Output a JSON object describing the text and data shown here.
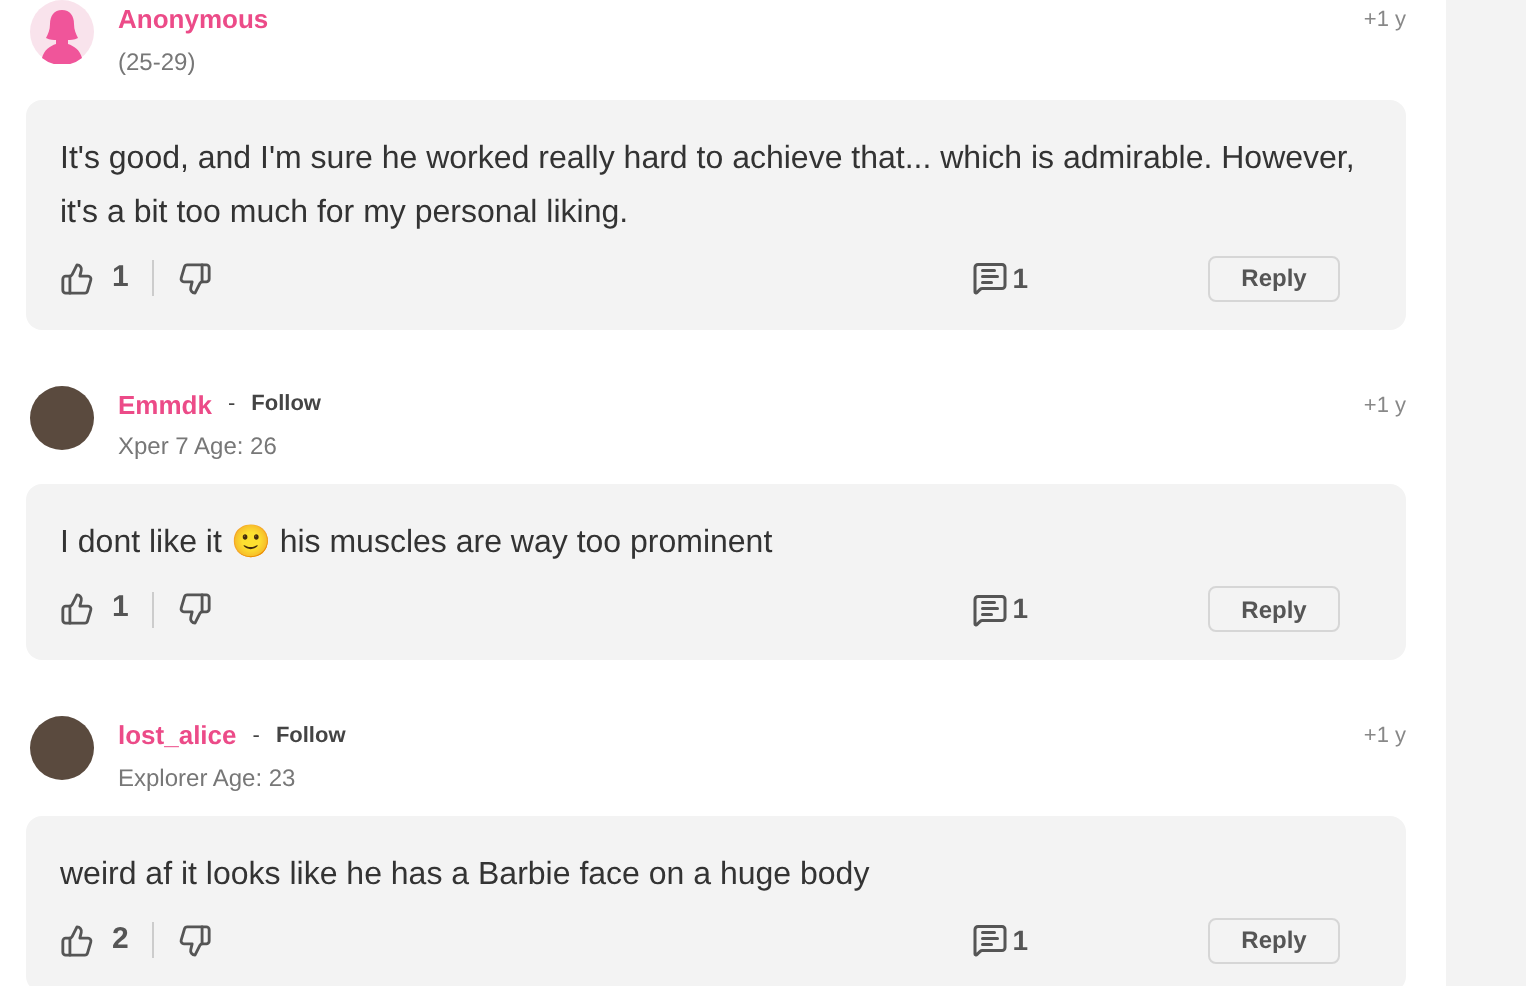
{
  "comments": [
    {
      "author": "Anonymous",
      "kind": "anonymous",
      "meta": "(25-29)",
      "time": "+1 y",
      "text": "It's good, and I'm sure he worked really hard to achieve that... which is admirable. However, it's a bit too much for my personal liking.",
      "likes": "1",
      "replies": "1",
      "reply_label": "Reply"
    },
    {
      "author": "Emmdk",
      "kind": "photo",
      "separator": "-",
      "follow": "Follow",
      "meta": "Xper 7 Age: 26",
      "time": "+1 y",
      "text": "I dont like it 🙂 his muscles are way too prominent",
      "likes": "1",
      "replies": "1",
      "reply_label": "Reply"
    },
    {
      "author": "lost_alice",
      "kind": "photo",
      "separator": "-",
      "follow": "Follow",
      "meta": "Explorer Age: 23",
      "time": "+1 y",
      "text": "weird af it looks like he has a Barbie face on a huge body",
      "likes": "2",
      "replies": "1",
      "reply_label": "Reply"
    }
  ]
}
